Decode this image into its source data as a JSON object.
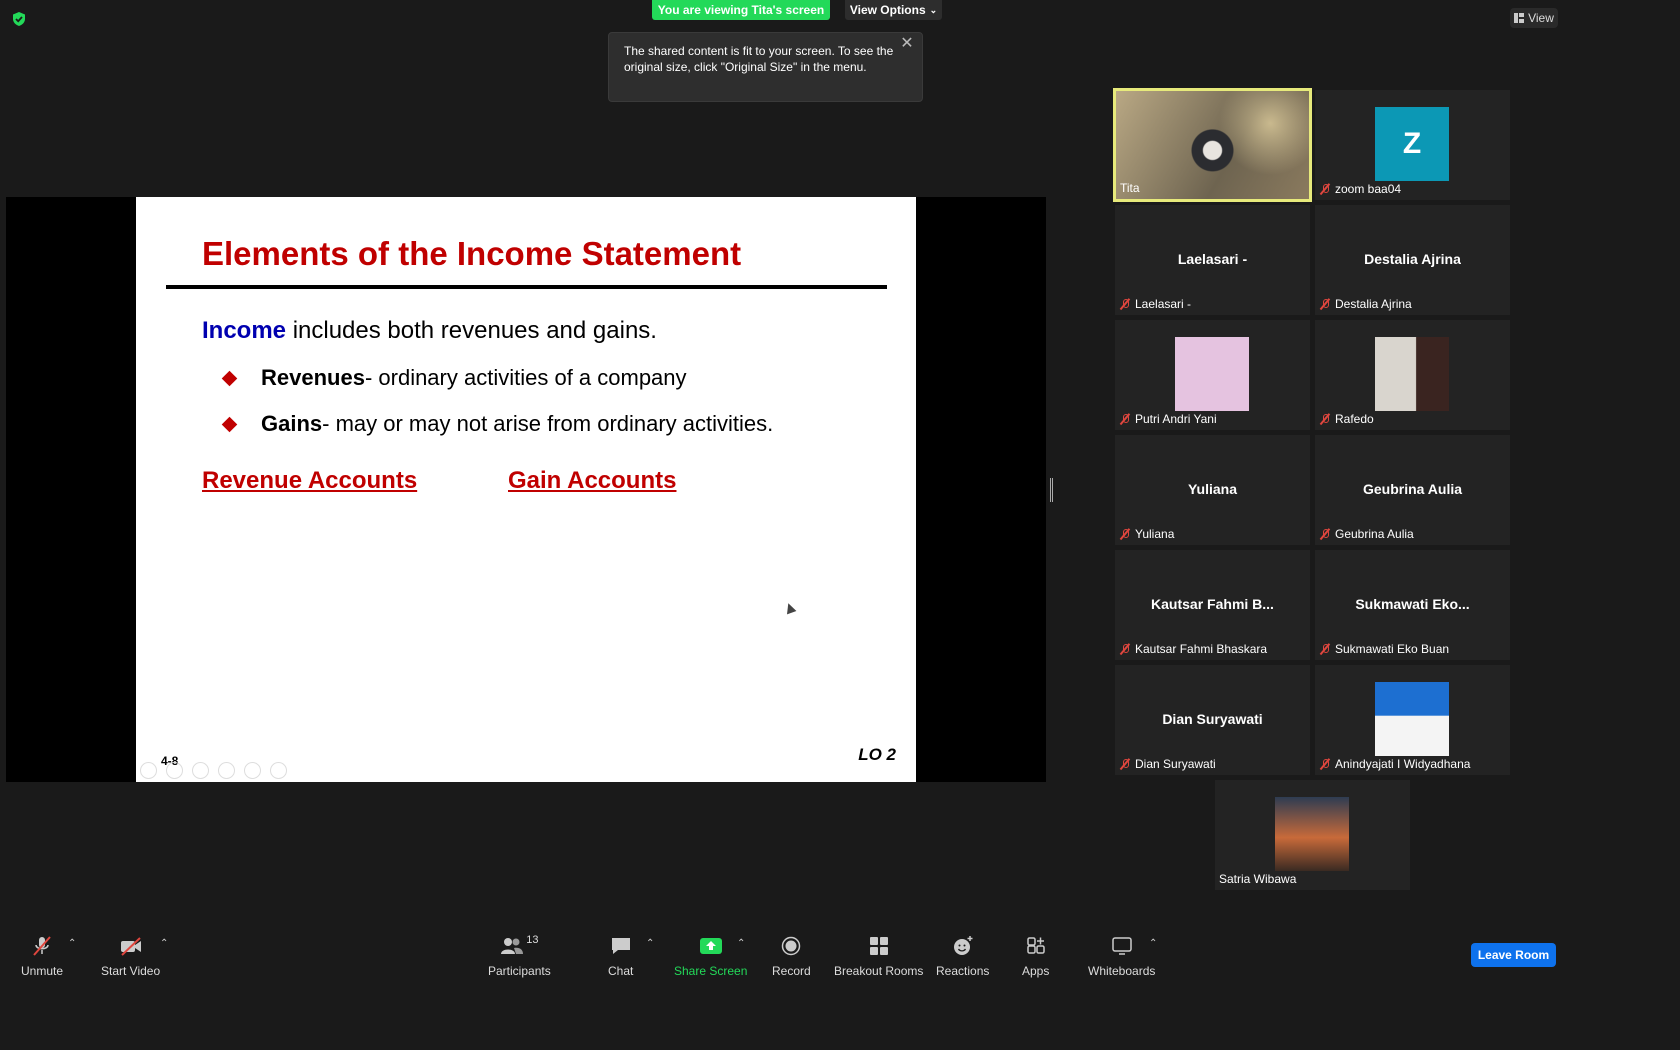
{
  "top": {
    "banner": "You are viewing Tita's screen",
    "view_options": "View Options",
    "view": "View"
  },
  "tooltip": {
    "text": "The shared content is fit to your screen. To see the original size, click \"Original Size\" in the menu."
  },
  "slide": {
    "title": "Elements of the Income Statement",
    "line1_keyword": "Income",
    "line1_rest": " includes both revenues and gains.",
    "bullets": [
      {
        "bold": "Revenues",
        "rest": " - ordinary activities of a company"
      },
      {
        "bold": "Gains",
        "rest": " - may or may not arise from ordinary activities."
      }
    ],
    "revenue_accounts": "Revenue Accounts",
    "gain_accounts": "Gain Accounts",
    "page_number": "4-8",
    "lo": "LO 2"
  },
  "participants": [
    {
      "label": "Tita"
    },
    {
      "label": "zoom baa04",
      "initial": "Z"
    },
    {
      "center": "Laelasari -",
      "label": "Laelasari -"
    },
    {
      "center": "Destalia Ajrina",
      "label": "Destalia Ajrina"
    },
    {
      "label": "Putri Andri Yani"
    },
    {
      "label": "Rafedo"
    },
    {
      "center": "Yuliana",
      "label": "Yuliana"
    },
    {
      "center": "Geubrina Aulia",
      "label": "Geubrina Aulia"
    },
    {
      "center": "Kautsar Fahmi B...",
      "label": "Kautsar Fahmi Bhaskara"
    },
    {
      "center": "Sukmawati  Eko...",
      "label": "Sukmawati Eko Buan"
    },
    {
      "center": "Dian Suryawati",
      "label": "Dian Suryawati"
    },
    {
      "label": "Anindyajati I Widyadhana"
    },
    {
      "label": "Satria Wibawa"
    }
  ],
  "toolbar": {
    "unmute": "Unmute",
    "start_video": "Start Video",
    "participants": "Participants",
    "participant_count": "13",
    "chat": "Chat",
    "share_screen": "Share Screen",
    "record": "Record",
    "breakout_rooms": "Breakout Rooms",
    "reactions": "Reactions",
    "apps": "Apps",
    "whiteboards": "Whiteboards",
    "leave_room": "Leave Room"
  },
  "colors": {
    "banner_green": "#23d959",
    "slide_red": "#c00000",
    "slide_blue": "#0000b0",
    "leave_blue": "#0e72ed",
    "active_speaker": "#e7ea7b"
  }
}
